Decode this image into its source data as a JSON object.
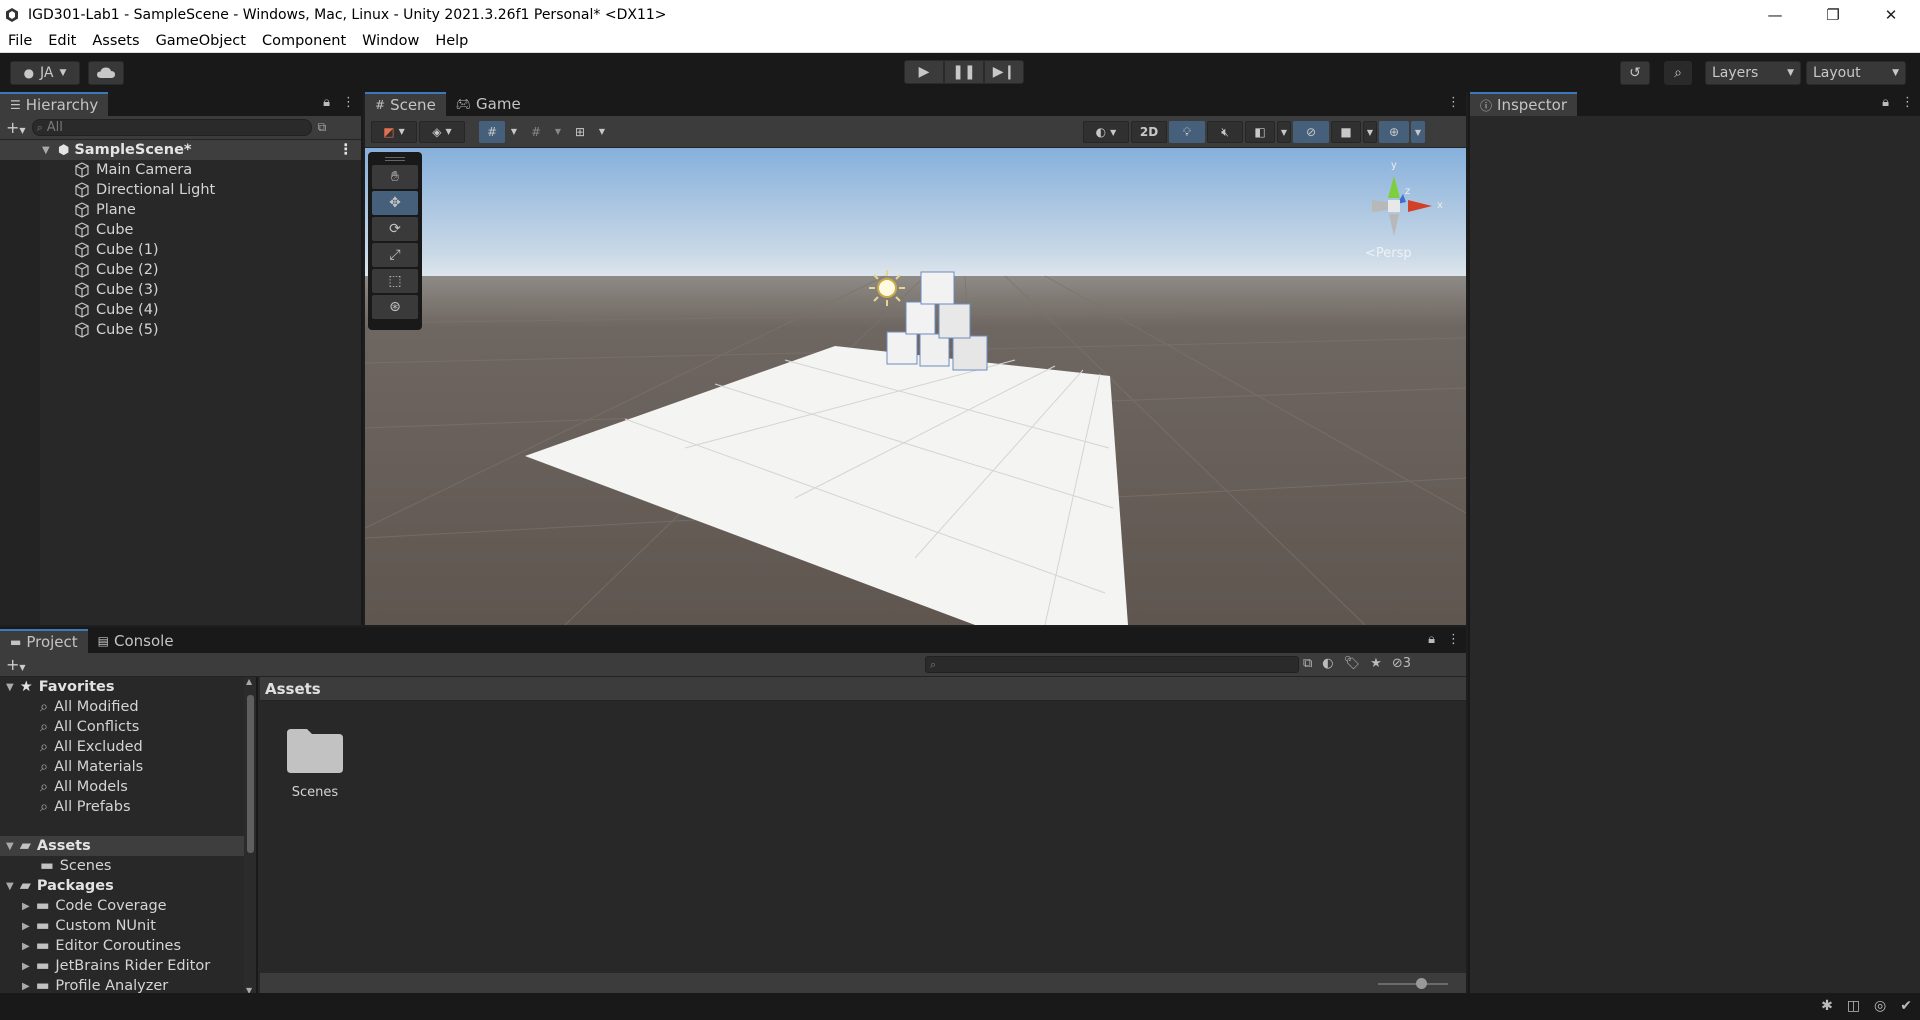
{
  "window": {
    "title": "IGD301-Lab1 - SampleScene - Windows, Mac, Linux - Unity 2021.3.26f1 Personal* <DX11>",
    "minimize": "—",
    "maximize": "❐",
    "close": "✕"
  },
  "menu": [
    "File",
    "Edit",
    "Assets",
    "GameObject",
    "Component",
    "Window",
    "Help"
  ],
  "toolbar": {
    "account": "JA",
    "layers": "Layers",
    "layout": "Layout"
  },
  "hierarchy": {
    "tab": "Hierarchy",
    "search_placeholder": "All",
    "scene": "SampleScene*",
    "items": [
      "Main Camera",
      "Directional Light",
      "Plane",
      "Cube",
      "Cube (1)",
      "Cube (2)",
      "Cube (3)",
      "Cube (4)",
      "Cube (5)"
    ]
  },
  "scene": {
    "tabs": [
      "Scene",
      "Game"
    ],
    "mode_2d": "2D",
    "persp": "Persp",
    "gizmo_y": "y",
    "gizmo_x": "x",
    "gizmo_z": "z"
  },
  "inspector": {
    "tab": "Inspector"
  },
  "project": {
    "tabs": [
      "Project",
      "Console"
    ],
    "hidden_count": "3",
    "favorites_header": "Favorites",
    "favorites": [
      "All Modified",
      "All Conflicts",
      "All Excluded",
      "All Materials",
      "All Models",
      "All Prefabs"
    ],
    "assets_header": "Assets",
    "assets_children": [
      "Scenes"
    ],
    "packages_header": "Packages",
    "packages": [
      "Code Coverage",
      "Custom NUnit",
      "Editor Coroutines",
      "JetBrains Rider Editor",
      "Profile Analyzer"
    ],
    "breadcrumb": "Assets",
    "folder_items": [
      "Scenes"
    ]
  },
  "colors": {
    "accent": "#3a79bb",
    "panel_bg": "#282828",
    "toolbar_bg": "#191919",
    "sky_top": "#86b0dc",
    "ground": "#655c55"
  }
}
